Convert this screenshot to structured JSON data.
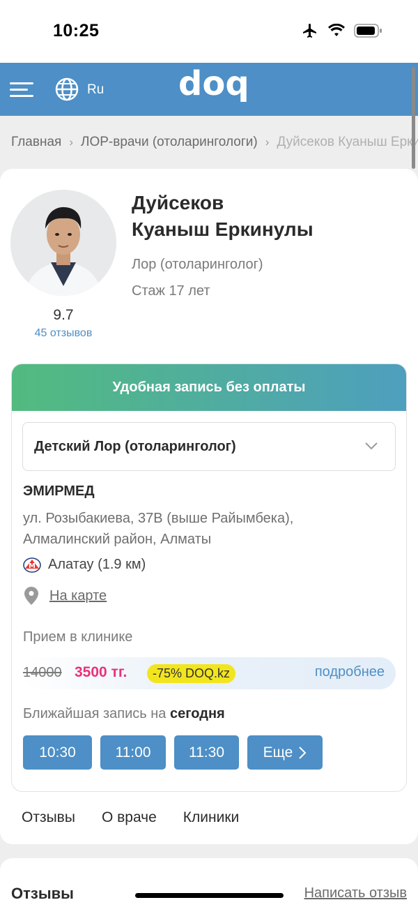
{
  "status_bar": {
    "time": "10:25"
  },
  "header": {
    "language": "Ru",
    "logo_text": "doq",
    "accent_color": "#4d8fc6"
  },
  "breadcrumb": [
    "Главная",
    "ЛОР-врачи (отоларингологи)",
    "Дуйсеков Куаныш Еркинулы"
  ],
  "doctor": {
    "name_line1": "Дуйсеков",
    "name_line2": "Куаныш Еркинулы",
    "specialty": "Лор (отоларинголог)",
    "experience": "Стаж 17 лет",
    "rating": "9.7",
    "reviews_count": "45 отзывов"
  },
  "booking": {
    "banner": "Удобная запись без оплаты",
    "selected_specialty": "Детский Лор (отоларинголог)",
    "clinic_name": "ЭМИРМЕД",
    "clinic_address": "ул. Розыбакиева, 37В (выше Райымбека), Алмалинский район, Алматы",
    "metro": "Алатау (1.9 км)",
    "map_link": "На карте",
    "reception_type": "Прием в клинике",
    "old_price": "14000",
    "new_price": "3500 тг.",
    "discount": "-75%  DOQ.kz",
    "more_link": "подробнее",
    "nearest_prefix": "Ближайшая запись на",
    "nearest_day": "сегодня",
    "slots": [
      "10:30",
      "11:00",
      "11:30"
    ],
    "more_slots": "Еще"
  },
  "tabs": [
    "Отзывы",
    "О враче",
    "Клиники"
  ],
  "reviews_section": {
    "title": "Отзывы",
    "write_review": "Написать отзыв"
  },
  "colors": {
    "banner_start": "#52bb7f",
    "banner_end": "#4e9fbe",
    "price": "#e8327c",
    "discount_badge": "#f2e51e"
  }
}
